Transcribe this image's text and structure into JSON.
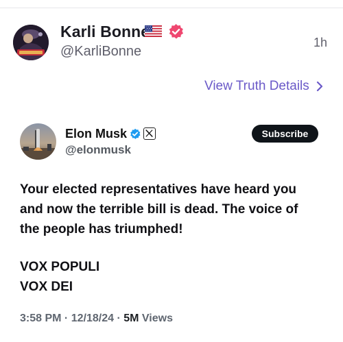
{
  "truth": {
    "author_name": "Karli Bonne’",
    "author_handle": "@KarliBonne",
    "time_ago": "1h",
    "view_details_label": "View Truth Details",
    "icons": {
      "flag": "us-flag-icon",
      "verified": "verified-badge-icon",
      "chevron": "chevron-right-icon"
    },
    "colors": {
      "accent": "#6a59c8",
      "verified_badge": "#ef4770"
    }
  },
  "embedded_post": {
    "author_name": "Elon Musk",
    "author_handle": "@elonmusk",
    "subscribe_label": "Subscribe",
    "paragraphs": [
      [
        "Your elected representatives have heard you",
        "and now the terrible bill is dead. The voice of",
        "the people has triumphed!"
      ],
      [
        "VOX POPULI",
        "VOX DEI"
      ]
    ],
    "time": "3:58 PM",
    "date": "12/18/24",
    "separator": "·",
    "views_count": "5M",
    "views_label": "Views",
    "icons": {
      "verified": "verified-check-icon",
      "platform": "x-logo-icon"
    },
    "colors": {
      "verified_badge": "#1d9bf0",
      "subscribe_bg": "#0f1419"
    }
  }
}
